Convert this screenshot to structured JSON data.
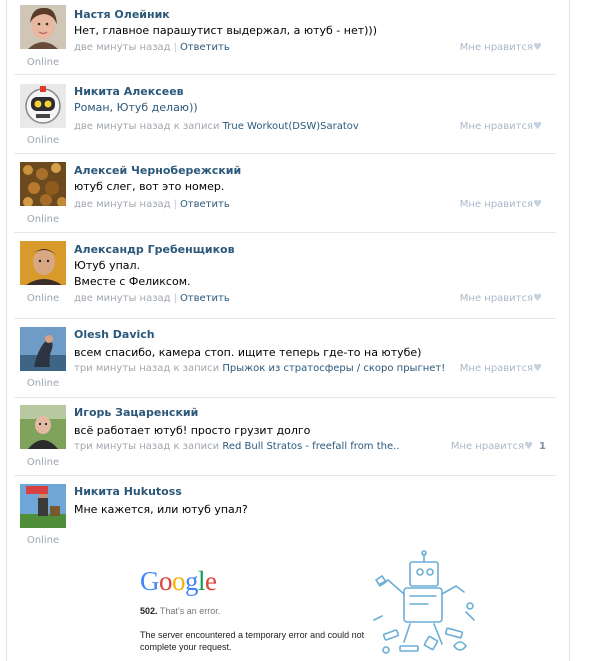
{
  "comments": [
    {
      "author": "Настя Олейник",
      "lines": [
        "Нет, главное парашутист выдержал, а ютуб - нет)))"
      ],
      "text_color": "#000000",
      "time": "две минуты назад",
      "action": "Ответить",
      "like_label": "Мне нравится",
      "like_count": "",
      "status": "Online",
      "avatar": "avatar-girl"
    },
    {
      "author": "Никита Алексеев",
      "lines": [
        "Роман, Ютуб делаю))"
      ],
      "text_color": "#2b587a",
      "time": "две минуты назад к записи",
      "link": "True Workout(DSW)Saratov",
      "like_label": "Мне нравится",
      "like_count": "",
      "status": "Online",
      "avatar": "avatar-robot"
    },
    {
      "author": "Алексей Чернобережский",
      "lines": [
        "ютуб слег, вот это номер."
      ],
      "time": "две минуты назад",
      "action": "Ответить",
      "like_label": "Мне нравится",
      "like_count": "",
      "status": "Online",
      "avatar": "avatar-bark"
    },
    {
      "author": "Александр Гребенщиков",
      "lines": [
        "Ютуб упал.",
        "Вместе с Феликсом."
      ],
      "time": "две минуты назад",
      "action": "Ответить",
      "like_label": "Мне нравится",
      "like_count": "",
      "status": "Online",
      "avatar": "avatar-man"
    },
    {
      "author": "Olesh Davich",
      "lines": [
        "всем спасибо, камера стоп. ищите теперь где-то на ютубе)"
      ],
      "time": "три минуты назад к записи",
      "link": "Прыжок из стратосферы / скоро прыгнет!",
      "like_label": "Мне нравится",
      "like_count": "",
      "status": "Online",
      "avatar": "avatar-sky"
    },
    {
      "author": "Игорь Зацаренский",
      "lines": [
        "всё работает ютуб! просто грузит долго"
      ],
      "time": "три минуты назад к записи",
      "link": "Red Bull Stratos - freefall from the..",
      "like_label": "Мне нравится",
      "like_count": "1",
      "status": "Online",
      "avatar": "avatar-outdoor"
    },
    {
      "author": "Никита Hukutoss",
      "lines": [
        "Мне кажется, или ютуб упал?"
      ],
      "status": "Online",
      "avatar": "avatar-minecraft"
    }
  ],
  "google_error": {
    "logo": [
      "G",
      "o",
      "o",
      "g",
      "l",
      "e"
    ],
    "code": "502.",
    "code_text": "That’s an error.",
    "message": "The server encountered a temporary error and could not complete your request."
  },
  "colors": {
    "author": "#2b587a",
    "meta": "#a1a7ae",
    "online": "#9aa5b1",
    "google_blue": "#4285f4",
    "google_red": "#db4437",
    "google_yellow": "#f4b400",
    "google_green": "#0f9d58"
  }
}
